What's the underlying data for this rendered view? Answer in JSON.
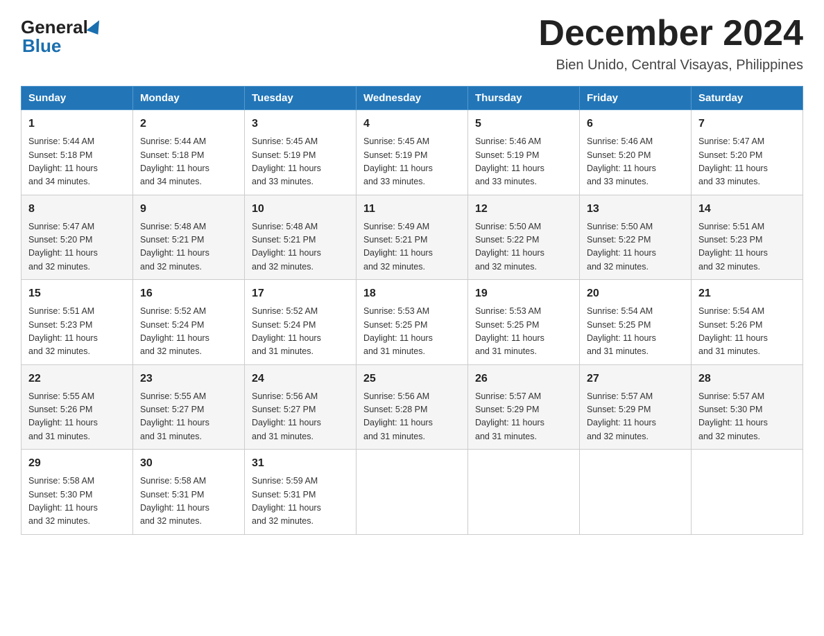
{
  "header": {
    "logo_line1": "General",
    "logo_line2": "Blue",
    "calendar_title": "December 2024",
    "calendar_subtitle": "Bien Unido, Central Visayas, Philippines"
  },
  "days_of_week": [
    "Sunday",
    "Monday",
    "Tuesday",
    "Wednesday",
    "Thursday",
    "Friday",
    "Saturday"
  ],
  "weeks": [
    [
      {
        "day": "1",
        "sunrise": "5:44 AM",
        "sunset": "5:18 PM",
        "daylight": "11 hours and 34 minutes."
      },
      {
        "day": "2",
        "sunrise": "5:44 AM",
        "sunset": "5:18 PM",
        "daylight": "11 hours and 34 minutes."
      },
      {
        "day": "3",
        "sunrise": "5:45 AM",
        "sunset": "5:19 PM",
        "daylight": "11 hours and 33 minutes."
      },
      {
        "day": "4",
        "sunrise": "5:45 AM",
        "sunset": "5:19 PM",
        "daylight": "11 hours and 33 minutes."
      },
      {
        "day": "5",
        "sunrise": "5:46 AM",
        "sunset": "5:19 PM",
        "daylight": "11 hours and 33 minutes."
      },
      {
        "day": "6",
        "sunrise": "5:46 AM",
        "sunset": "5:20 PM",
        "daylight": "11 hours and 33 minutes."
      },
      {
        "day": "7",
        "sunrise": "5:47 AM",
        "sunset": "5:20 PM",
        "daylight": "11 hours and 33 minutes."
      }
    ],
    [
      {
        "day": "8",
        "sunrise": "5:47 AM",
        "sunset": "5:20 PM",
        "daylight": "11 hours and 32 minutes."
      },
      {
        "day": "9",
        "sunrise": "5:48 AM",
        "sunset": "5:21 PM",
        "daylight": "11 hours and 32 minutes."
      },
      {
        "day": "10",
        "sunrise": "5:48 AM",
        "sunset": "5:21 PM",
        "daylight": "11 hours and 32 minutes."
      },
      {
        "day": "11",
        "sunrise": "5:49 AM",
        "sunset": "5:21 PM",
        "daylight": "11 hours and 32 minutes."
      },
      {
        "day": "12",
        "sunrise": "5:50 AM",
        "sunset": "5:22 PM",
        "daylight": "11 hours and 32 minutes."
      },
      {
        "day": "13",
        "sunrise": "5:50 AM",
        "sunset": "5:22 PM",
        "daylight": "11 hours and 32 minutes."
      },
      {
        "day": "14",
        "sunrise": "5:51 AM",
        "sunset": "5:23 PM",
        "daylight": "11 hours and 32 minutes."
      }
    ],
    [
      {
        "day": "15",
        "sunrise": "5:51 AM",
        "sunset": "5:23 PM",
        "daylight": "11 hours and 32 minutes."
      },
      {
        "day": "16",
        "sunrise": "5:52 AM",
        "sunset": "5:24 PM",
        "daylight": "11 hours and 32 minutes."
      },
      {
        "day": "17",
        "sunrise": "5:52 AM",
        "sunset": "5:24 PM",
        "daylight": "11 hours and 31 minutes."
      },
      {
        "day": "18",
        "sunrise": "5:53 AM",
        "sunset": "5:25 PM",
        "daylight": "11 hours and 31 minutes."
      },
      {
        "day": "19",
        "sunrise": "5:53 AM",
        "sunset": "5:25 PM",
        "daylight": "11 hours and 31 minutes."
      },
      {
        "day": "20",
        "sunrise": "5:54 AM",
        "sunset": "5:25 PM",
        "daylight": "11 hours and 31 minutes."
      },
      {
        "day": "21",
        "sunrise": "5:54 AM",
        "sunset": "5:26 PM",
        "daylight": "11 hours and 31 minutes."
      }
    ],
    [
      {
        "day": "22",
        "sunrise": "5:55 AM",
        "sunset": "5:26 PM",
        "daylight": "11 hours and 31 minutes."
      },
      {
        "day": "23",
        "sunrise": "5:55 AM",
        "sunset": "5:27 PM",
        "daylight": "11 hours and 31 minutes."
      },
      {
        "day": "24",
        "sunrise": "5:56 AM",
        "sunset": "5:27 PM",
        "daylight": "11 hours and 31 minutes."
      },
      {
        "day": "25",
        "sunrise": "5:56 AM",
        "sunset": "5:28 PM",
        "daylight": "11 hours and 31 minutes."
      },
      {
        "day": "26",
        "sunrise": "5:57 AM",
        "sunset": "5:29 PM",
        "daylight": "11 hours and 31 minutes."
      },
      {
        "day": "27",
        "sunrise": "5:57 AM",
        "sunset": "5:29 PM",
        "daylight": "11 hours and 32 minutes."
      },
      {
        "day": "28",
        "sunrise": "5:57 AM",
        "sunset": "5:30 PM",
        "daylight": "11 hours and 32 minutes."
      }
    ],
    [
      {
        "day": "29",
        "sunrise": "5:58 AM",
        "sunset": "5:30 PM",
        "daylight": "11 hours and 32 minutes."
      },
      {
        "day": "30",
        "sunrise": "5:58 AM",
        "sunset": "5:31 PM",
        "daylight": "11 hours and 32 minutes."
      },
      {
        "day": "31",
        "sunrise": "5:59 AM",
        "sunset": "5:31 PM",
        "daylight": "11 hours and 32 minutes."
      },
      null,
      null,
      null,
      null
    ]
  ],
  "labels": {
    "sunrise": "Sunrise:",
    "sunset": "Sunset:",
    "daylight": "Daylight:"
  }
}
